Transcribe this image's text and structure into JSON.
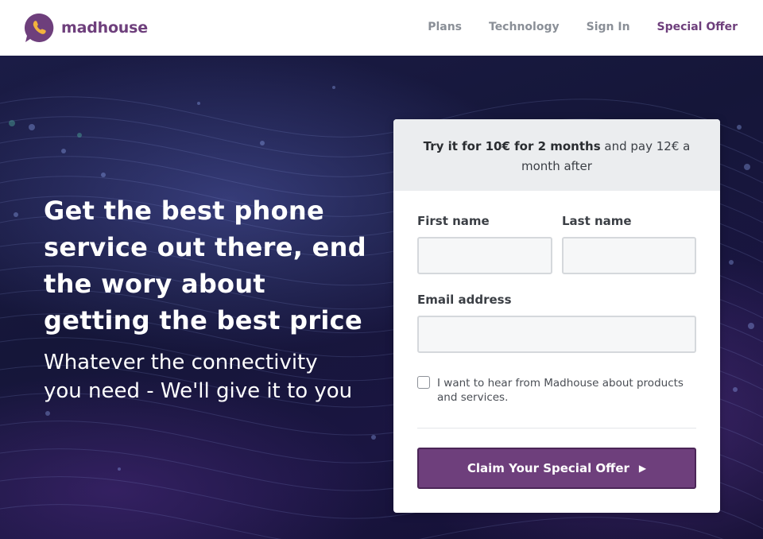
{
  "brand": {
    "name": "madhouse",
    "logo_icon": "phone-chat-bubble-icon",
    "brand_color": "#6e3f7c"
  },
  "nav": {
    "items": [
      {
        "label": "Plans"
      },
      {
        "label": "Technology"
      },
      {
        "label": "Sign In"
      },
      {
        "label": "Special Offer"
      }
    ]
  },
  "hero": {
    "title": "Get the best phone service out there, end the wory about getting the best price",
    "subtitle": "Whatever the connectivity you need - We'll give it to you"
  },
  "form": {
    "offer_bold": "Try it for 10€ for 2 months",
    "offer_rest": " and pay 12€ a month after",
    "first_name_label": "First name",
    "first_name_value": "",
    "last_name_label": "Last name",
    "last_name_value": "",
    "email_label": "Email address",
    "email_value": "",
    "consent_text": "I want to hear from Madhouse about products and services.",
    "consent_checked": false,
    "submit_label": "Claim Your Special Offer",
    "submit_icon": "play-triangle-icon"
  }
}
